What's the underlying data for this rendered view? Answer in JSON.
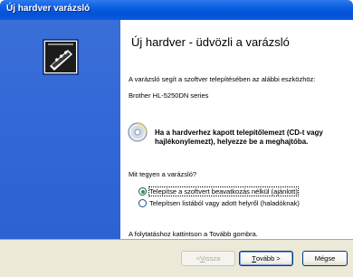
{
  "window": {
    "title": "Új hardver varázsló"
  },
  "main": {
    "heading": "Új hardver - üdvözli a varázsló",
    "intro": "A varázsló segít a szoftver telepítésében az alábbi eszközhöz:",
    "device_name": "Brother HL-5250DN series",
    "cd_prompt": "Ha a hardverhez kapott telepítőlemezt (CD-t vagy hajlékonylemezt), helyezze be a meghajtóba.",
    "question": "Mit tegyen a varázsló?",
    "options": [
      {
        "label": "Telepítse a szoftvert beavatkozás nélkül (ajánlott)",
        "selected": true
      },
      {
        "label": "Telepítsen listából vagy adott helyről (haladóknak)",
        "selected": false
      }
    ],
    "footer_note": "A folytatáshoz kattintson a Tovább gombra."
  },
  "buttons": {
    "back": {
      "prefix": "< ",
      "key": "V",
      "rest": "issza",
      "enabled": false
    },
    "next": {
      "key": "T",
      "rest": "ovább >"
    },
    "cancel": {
      "label": "Mégse"
    }
  },
  "icons": {
    "hardware": "hardware-card-icon",
    "cd": "cd-icon"
  },
  "colors": {
    "titlebar": "#0a5ee0",
    "left_panel": "#3066d6",
    "bottom_bar": "#ece9d8"
  }
}
